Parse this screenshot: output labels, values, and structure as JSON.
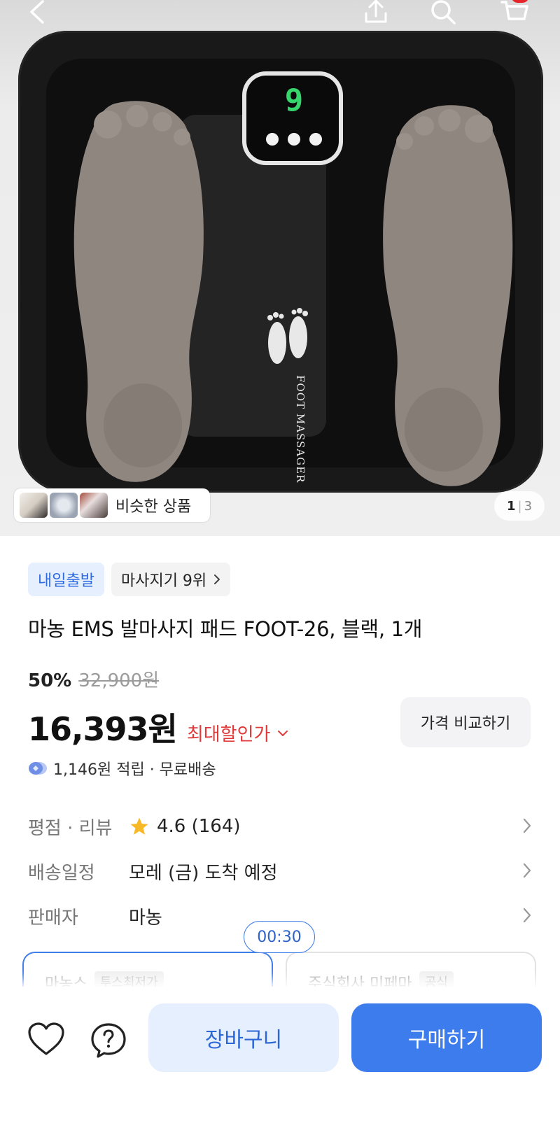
{
  "header": {
    "icons": [
      "back-icon",
      "share-icon",
      "search-icon",
      "cart-icon"
    ],
    "cart_badge_color": "#e5252a"
  },
  "gallery": {
    "device_text": "FOOT MASSAGER",
    "display_digit": "9",
    "similar_label": "비슷한 상품",
    "pager_current": "1",
    "pager_sep": "|",
    "pager_total": "3"
  },
  "product": {
    "tag_delivery": "내일출발",
    "tag_rank": "마사지기 9위",
    "title": "마농 EMS 발마사지 패드 FOOT-26, 블랙, 1개",
    "discount_rate": "50%",
    "original_price": "32,900원",
    "price": "16,393원",
    "best_price_label": "최대할인가",
    "compare_label": "가격 비교하기",
    "points": "1,146원 적립 · 무료배송"
  },
  "info": {
    "rating_label": "평점 · 리뷰",
    "rating_value": "4.6 (164)",
    "shipping_label": "배송일정",
    "shipping_value": "모레 (금) 도착 예정",
    "seller_label": "판매자",
    "seller_value": "마농"
  },
  "seller_cards": {
    "timer": "00:30",
    "left_name": "마농스",
    "left_badge": "투스최저가",
    "right_name": "주식회사 미페마",
    "right_badge": "공식"
  },
  "bottom": {
    "cart_label": "장바구니",
    "buy_label": "구매하기"
  },
  "colors": {
    "accent": "#3d7cec",
    "sale_red": "#e03a3a",
    "tag_blue_bg": "#e6effd"
  }
}
